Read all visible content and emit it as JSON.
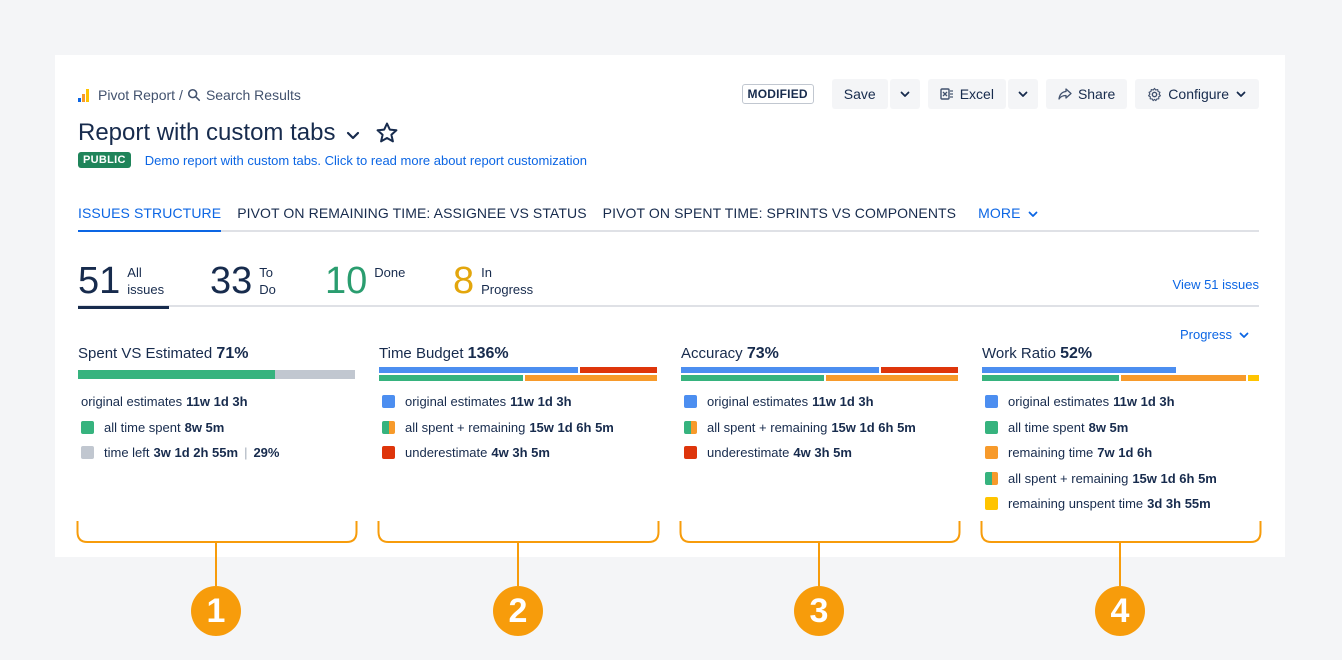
{
  "breadcrumb": {
    "home": "Pivot Report",
    "separator": "/",
    "current": "Search Results"
  },
  "toolbar": {
    "modified_badge": "MODIFIED",
    "save_label": "Save",
    "excel_label": "Excel",
    "share_label": "Share",
    "configure_label": "Configure"
  },
  "report": {
    "title": "Report with custom tabs",
    "visibility": "PUBLIC",
    "description": "Demo report with custom tabs. Click to read more about report customization"
  },
  "tabs": [
    {
      "label": "ISSUES STRUCTURE",
      "active": true
    },
    {
      "label": "PIVOT ON REMAINING TIME: ASSIGNEE VS STATUS",
      "active": false
    },
    {
      "label": "PIVOT ON SPENT TIME: SPRINTS VS COMPONENTS",
      "active": false
    }
  ],
  "more_tab": "MORE",
  "stats": [
    {
      "value": "51",
      "label": "All issues",
      "color": "#172b4d"
    },
    {
      "value": "33",
      "label": "To Do",
      "color": "#172b4d"
    },
    {
      "value": "10",
      "label": "Done",
      "color": "#2a9d6f"
    },
    {
      "value": "8",
      "label": "In Progress",
      "color": "#e3a60c"
    }
  ],
  "view_issues_link": "View 51 issues",
  "progress_dropdown": "Progress",
  "metrics": {
    "spent_vs_estimated": {
      "label": "Spent VS Estimated",
      "percent": "71%",
      "bar_fill_fraction": 0.71,
      "legend": {
        "original_label": "original estimates",
        "original_value": "11w 1d 3h",
        "spent_label": "all time spent",
        "spent_value": "8w 5m",
        "left_label": "time left",
        "left_value": "3w 1d 2h 55m",
        "left_pipe": "|",
        "left_percent": "29%"
      }
    },
    "time_budget": {
      "label": "Time Budget",
      "percent": "136%",
      "legend": {
        "original_label": "original estimates",
        "original_value": "11w 1d 3h",
        "allspent_label": "all spent + remaining",
        "allspent_value": "15w 1d 6h 5m",
        "under_label": "underestimate",
        "under_value": "4w 3h 5m"
      }
    },
    "accuracy": {
      "label": "Accuracy",
      "percent": "73%",
      "legend": {
        "original_label": "original estimates",
        "original_value": "11w 1d 3h",
        "allspent_label": "all spent + remaining",
        "allspent_value": "15w 1d 6h 5m",
        "under_label": "underestimate",
        "under_value": "4w 3h 5m"
      }
    },
    "work_ratio": {
      "label": "Work Ratio",
      "percent": "52%",
      "legend": {
        "original_label": "original estimates",
        "original_value": "11w 1d 3h",
        "spent_label": "all time spent",
        "spent_value": "8w 5m",
        "remaining_label": "remaining time",
        "remaining_value": "7w 1d 6h",
        "allspent_label": "all spent + remaining",
        "allspent_value": "15w 1d 6h 5m",
        "unspent_label": "remaining unspent time",
        "unspent_value": "3d 3h 55m"
      }
    }
  },
  "callouts": [
    "1",
    "2",
    "3",
    "4"
  ],
  "colors": {
    "blue": "#4c8ef0",
    "green": "#36b37e",
    "gray": "#c1c7d0",
    "orange": "#f79a2b",
    "red": "#de350b",
    "yellow": "#ffc400",
    "callout": "#f79c0b"
  }
}
